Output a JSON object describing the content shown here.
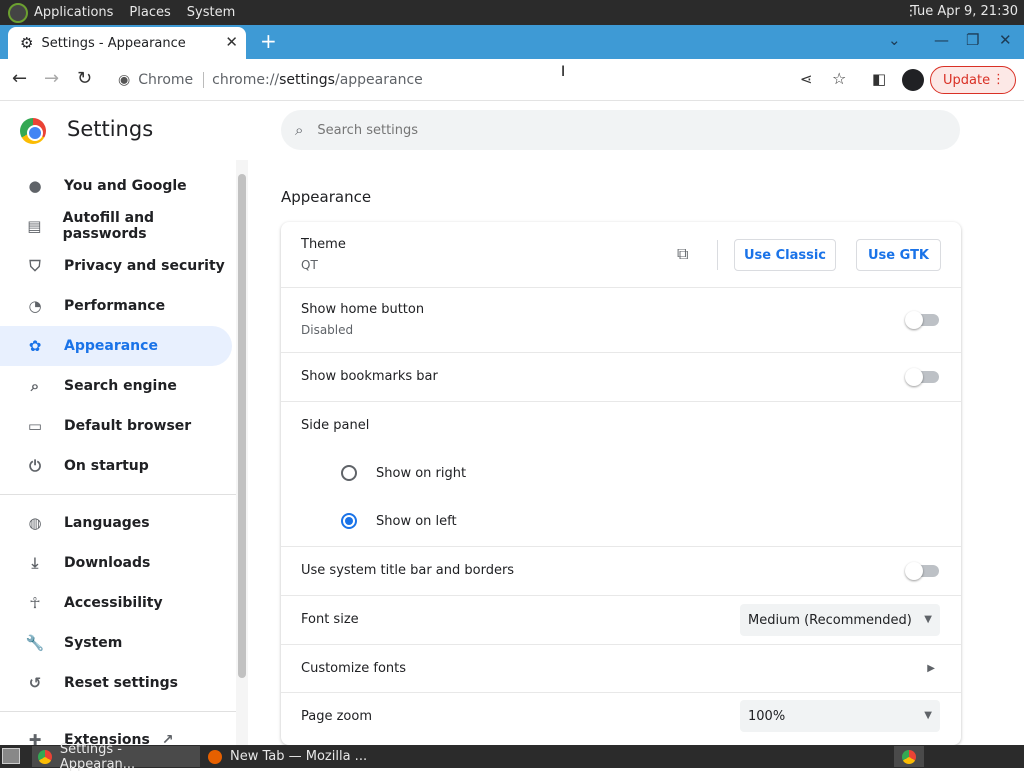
{
  "os_panel": {
    "menus": [
      "Applications",
      "Places",
      "System"
    ],
    "clock": "Tue Apr 9, 21:30"
  },
  "browser": {
    "tab_title": "Settings - Appearance",
    "omnibox": {
      "chip": "Chrome",
      "url_prefix": "chrome://",
      "url_host": "settings",
      "url_path": "/appearance"
    },
    "update_label": "Update"
  },
  "settings": {
    "title": "Settings",
    "search_placeholder": "Search settings",
    "nav": [
      {
        "label": "You and Google",
        "icon": "person-icon"
      },
      {
        "label": "Autofill and passwords",
        "icon": "clipboard-icon"
      },
      {
        "label": "Privacy and security",
        "icon": "shield-icon"
      },
      {
        "label": "Performance",
        "icon": "speedometer-icon"
      },
      {
        "label": "Appearance",
        "icon": "palette-icon"
      },
      {
        "label": "Search engine",
        "icon": "search-icon"
      },
      {
        "label": "Default browser",
        "icon": "browser-window-icon"
      },
      {
        "label": "On startup",
        "icon": "power-icon"
      },
      {
        "label": "Languages",
        "icon": "globe-icon"
      },
      {
        "label": "Downloads",
        "icon": "download-icon"
      },
      {
        "label": "Accessibility",
        "icon": "accessibility-icon"
      },
      {
        "label": "System",
        "icon": "wrench-icon"
      },
      {
        "label": "Reset settings",
        "icon": "history-icon"
      },
      {
        "label": "Extensions",
        "icon": "puzzle-icon"
      }
    ],
    "section_title": "Appearance",
    "theme": {
      "label": "Theme",
      "value": "QT",
      "btn_classic": "Use Classic",
      "btn_gtk": "Use GTK"
    },
    "home_button": {
      "label": "Show home button",
      "value": "Disabled",
      "enabled": false
    },
    "bookmarks_bar": {
      "label": "Show bookmarks bar",
      "enabled": false
    },
    "side_panel": {
      "label": "Side panel",
      "options": [
        "Show on right",
        "Show on left"
      ],
      "selected": "Show on left"
    },
    "system_title_bar": {
      "label": "Use system title bar and borders",
      "enabled": false
    },
    "font_size": {
      "label": "Font size",
      "value": "Medium (Recommended)"
    },
    "customize_fonts": {
      "label": "Customize fonts"
    },
    "page_zoom": {
      "label": "Page zoom",
      "value": "100%"
    }
  },
  "taskbar": {
    "tasks": [
      "Settings - Appearan...",
      "New Tab — Mozilla ..."
    ]
  },
  "colors": {
    "accent": "#1a73e8",
    "tabstrip": "#3e9ad5",
    "update": "#d93025"
  }
}
